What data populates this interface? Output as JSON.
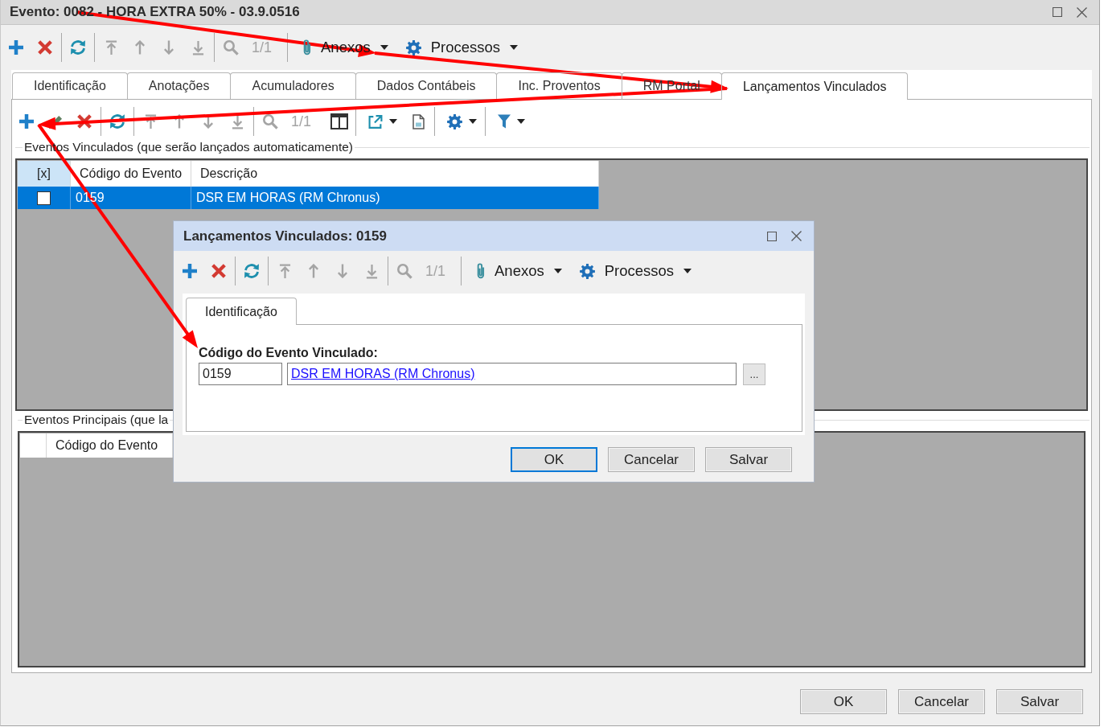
{
  "window": {
    "title": "Evento: 0082 - HORA EXTRA 50% - 03.9.0516"
  },
  "toolbar": {
    "groups": [
      [
        {
          "kind": "add",
          "disabled": false
        },
        {
          "kind": "delete",
          "disabled": false
        }
      ],
      [
        {
          "kind": "refresh",
          "disabled": false
        }
      ],
      [
        {
          "kind": "first",
          "disabled": true
        },
        {
          "kind": "previous",
          "disabled": true
        },
        {
          "kind": "next",
          "disabled": true
        },
        {
          "kind": "last",
          "disabled": true
        }
      ],
      [
        {
          "kind": "search",
          "disabled": true
        },
        {
          "kind": "counter",
          "label": "1/1",
          "disabled": true
        }
      ]
    ],
    "menus": [
      {
        "kind": "attach",
        "label": "Anexos"
      },
      {
        "kind": "gear",
        "label": "Processos"
      }
    ]
  },
  "tabs": [
    {
      "label": "Identificação",
      "selected": false
    },
    {
      "label": "Anotações",
      "selected": false
    },
    {
      "label": "Acumuladores",
      "selected": false
    },
    {
      "label": "Dados Contábeis",
      "selected": false
    },
    {
      "label": "Inc. Proventos",
      "selected": false
    },
    {
      "label": "RM Portal",
      "selected": false
    },
    {
      "label": "Lançamentos Vinculados",
      "selected": true
    }
  ],
  "tab_panel": {
    "toolbar": {
      "groups": [
        [
          {
            "kind": "add",
            "disabled": false
          },
          {
            "kind": "edit",
            "disabled": false
          },
          {
            "kind": "delete",
            "disabled": false
          }
        ],
        [
          {
            "kind": "refresh",
            "disabled": false
          }
        ],
        [
          {
            "kind": "first",
            "disabled": true
          },
          {
            "kind": "previous",
            "disabled": true
          },
          {
            "kind": "next",
            "disabled": true
          },
          {
            "kind": "last",
            "disabled": true
          }
        ],
        [
          {
            "kind": "search",
            "disabled": true
          },
          {
            "kind": "counter",
            "label": "1/1",
            "disabled": true
          },
          {
            "kind": "columns",
            "disabled": false
          }
        ],
        [
          {
            "kind": "export",
            "disabled": false
          },
          {
            "kind": "document",
            "disabled": false
          }
        ],
        [
          {
            "kind": "gear",
            "disabled": false
          }
        ],
        [
          {
            "kind": "filter",
            "disabled": false
          }
        ]
      ]
    },
    "linked_events": {
      "legend": "Eventos Vinculados (que serão lançados automaticamente)",
      "columns": [
        {
          "kind": "checkbox",
          "label": "[x]"
        },
        {
          "kind": "text",
          "label": "Código do Evento"
        },
        {
          "kind": "text",
          "label": "Descrição"
        }
      ],
      "rows": [
        {
          "checked": false,
          "code": "0159",
          "description": "DSR EM HORAS (RM Chronus)",
          "selected": true
        }
      ]
    },
    "main_events": {
      "legend": "Eventos Principais (que la",
      "columns": [
        {
          "kind": "row_header"
        },
        {
          "kind": "text",
          "label": "Código do Evento"
        }
      ]
    }
  },
  "dialog": {
    "title": "Lançamentos Vinculados: 0159",
    "toolbar": {
      "groups": [
        [
          {
            "kind": "add",
            "disabled": false
          },
          {
            "kind": "delete",
            "disabled": false
          }
        ],
        [
          {
            "kind": "refresh",
            "disabled": false
          }
        ],
        [
          {
            "kind": "first",
            "disabled": true
          },
          {
            "kind": "previous",
            "disabled": true
          },
          {
            "kind": "next",
            "disabled": true
          },
          {
            "kind": "last",
            "disabled": true
          }
        ],
        [
          {
            "kind": "search",
            "disabled": true
          },
          {
            "kind": "counter",
            "label": "1/1",
            "disabled": true
          }
        ]
      ],
      "menus": [
        {
          "kind": "attach",
          "label": "Anexos"
        },
        {
          "kind": "gear",
          "label": "Processos"
        }
      ]
    },
    "tabs": [
      {
        "label": "Identificação",
        "selected": true
      }
    ],
    "field": {
      "label": "Código do Evento Vinculado:",
      "code": "0159",
      "link": "DSR EM HORAS (RM Chronus)",
      "lookup": "..."
    },
    "buttons": [
      {
        "label": "OK",
        "default": true
      },
      {
        "label": "Cancelar",
        "default": false
      },
      {
        "label": "Salvar",
        "default": false
      }
    ]
  },
  "buttons": [
    {
      "label": "OK",
      "default": false
    },
    {
      "label": "Cancelar",
      "default": false
    },
    {
      "label": "Salvar",
      "default": false
    }
  ],
  "annotations": [
    {
      "kind": "arrow"
    },
    {
      "kind": "arrow"
    },
    {
      "kind": "arrow"
    },
    {
      "kind": "arrow"
    }
  ]
}
